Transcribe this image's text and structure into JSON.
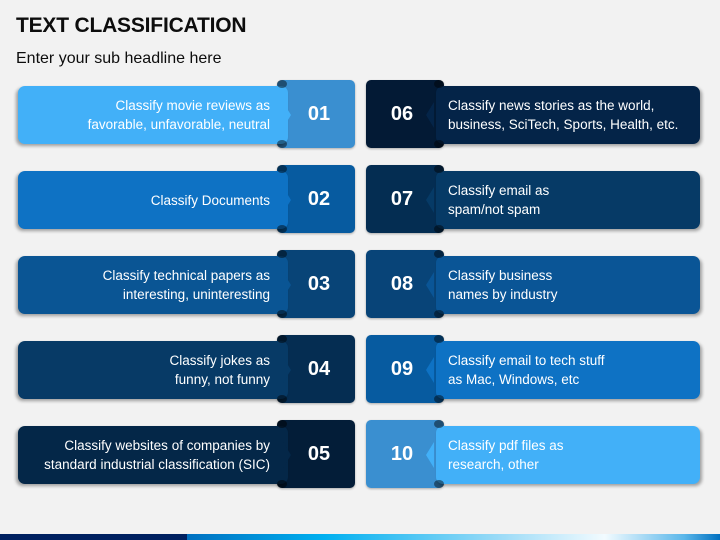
{
  "header": {
    "title": "TEXT CLASSIFICATION",
    "subtitle": "Enter your sub headline here"
  },
  "items": [
    {
      "number": "01",
      "text": "Classify movie reviews as\nfavorable, unfavorable, neutral",
      "banner_color": "#42b0f8",
      "box_color": "#3a8fd0"
    },
    {
      "number": "02",
      "text": "Classify Documents",
      "banner_color": "#0e72c4",
      "box_color": "#075ba0"
    },
    {
      "number": "03",
      "text": "Classify technical papers as\ninteresting, uninteresting",
      "banner_color": "#0a5594",
      "box_color": "#084477"
    },
    {
      "number": "04",
      "text": "Classify jokes as\nfunny, not funny",
      "banner_color": "#073a66",
      "box_color": "#052d52"
    },
    {
      "number": "05",
      "text": "Classify websites of companies by\nstandard industrial classification (SIC)",
      "banner_color": "#042748",
      "box_color": "#031d38"
    },
    {
      "number": "06",
      "text": "Classify news stories as the world,\nbusiness, SciTech, Sports, Health, etc.",
      "banner_color": "#042448",
      "box_color": "#031a35"
    },
    {
      "number": "07",
      "text": "Classify email as\nspam/not spam",
      "banner_color": "#063a66",
      "box_color": "#042d52"
    },
    {
      "number": "08",
      "text": "Classify business\nnames by industry",
      "banner_color": "#0a5596",
      "box_color": "#084478"
    },
    {
      "number": "09",
      "text": "Classify email to tech stuff\nas Mac, Windows, etc",
      "banner_color": "#0e72c4",
      "box_color": "#075ba0"
    },
    {
      "number": "10",
      "text": "Classify pdf files as\nresearch, other",
      "banner_color": "#42b0f8",
      "box_color": "#3a8fd0"
    }
  ]
}
